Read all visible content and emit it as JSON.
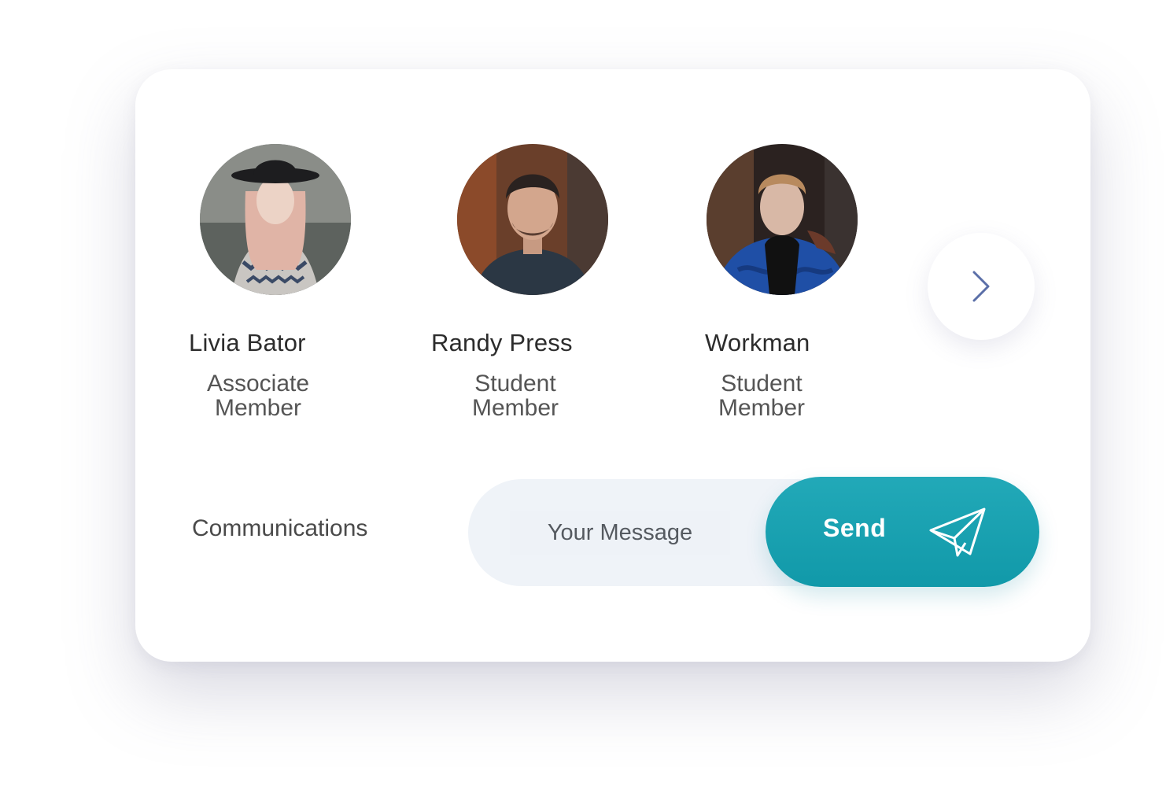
{
  "members": [
    {
      "name": "Livia Bator",
      "role_line1": "Associate",
      "role_line2": "Member"
    },
    {
      "name": "Randy Press",
      "role_line1": "Student",
      "role_line2": "Member"
    },
    {
      "name": "Workman",
      "role_line1": "Student",
      "role_line2": "Member"
    }
  ],
  "next_icon": "chevron-right-icon",
  "communications": {
    "label": "Communications",
    "message_placeholder": "Your Message",
    "send_label": "Send",
    "send_icon": "paper-plane-icon"
  },
  "colors": {
    "accent": "#1aa0b0",
    "input_bg": "#eff3f8",
    "chevron": "#5b6fa8"
  }
}
